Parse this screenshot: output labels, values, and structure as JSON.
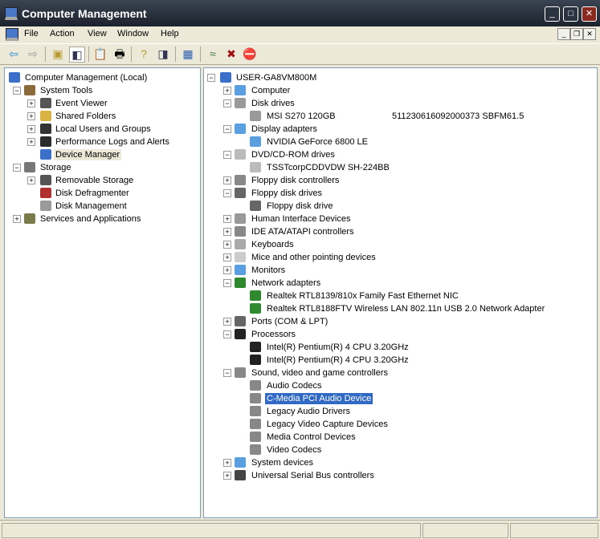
{
  "window": {
    "title": "Computer Management",
    "minimize": "_",
    "maximize": "□",
    "close": "✕"
  },
  "menu": [
    "File",
    "Action",
    "View",
    "Window",
    "Help"
  ],
  "toolbar": [
    "back-icon",
    "forward-icon",
    "up-folder-icon",
    "show-hide-tree-icon",
    "properties-icon",
    "print-icon",
    "help-icon",
    "console-icon",
    "scan-hardware-icon",
    "update-driver-icon",
    "uninstall-icon",
    "disable-icon"
  ],
  "left_tree": [
    {
      "label": "Computer Management (Local)",
      "level": 0,
      "exp": "",
      "icon": "computer"
    },
    {
      "label": "System Tools",
      "level": 1,
      "exp": "−",
      "icon": "tools"
    },
    {
      "label": "Event Viewer",
      "level": 2,
      "exp": "+",
      "icon": "event"
    },
    {
      "label": "Shared Folders",
      "level": 2,
      "exp": "+",
      "icon": "folder"
    },
    {
      "label": "Local Users and Groups",
      "level": 2,
      "exp": "+",
      "icon": "users"
    },
    {
      "label": "Performance Logs and Alerts",
      "level": 2,
      "exp": "+",
      "icon": "perf"
    },
    {
      "label": "Device Manager",
      "level": 2,
      "exp": "",
      "icon": "device",
      "state": "gsel"
    },
    {
      "label": "Storage",
      "level": 1,
      "exp": "−",
      "icon": "storage"
    },
    {
      "label": "Removable Storage",
      "level": 2,
      "exp": "+",
      "icon": "removable"
    },
    {
      "label": "Disk Defragmenter",
      "level": 2,
      "exp": "",
      "icon": "defrag"
    },
    {
      "label": "Disk Management",
      "level": 2,
      "exp": "",
      "icon": "disk"
    },
    {
      "label": "Services and Applications",
      "level": 1,
      "exp": "+",
      "icon": "services"
    }
  ],
  "right_tree": [
    {
      "label": "USER-GA8VM800M",
      "level": 0,
      "exp": "−",
      "icon": "computer"
    },
    {
      "label": "Computer",
      "level": 1,
      "exp": "+",
      "icon": "monitor"
    },
    {
      "label": "Disk drives",
      "level": 1,
      "exp": "−",
      "icon": "disk"
    },
    {
      "label": "MSI S270 120GB",
      "level": 2,
      "icon": "disk",
      "extra": "511230616092000373  SBFM61.5"
    },
    {
      "label": "Display adapters",
      "level": 1,
      "exp": "−",
      "icon": "monitor"
    },
    {
      "label": "NVIDIA GeForce 6800 LE",
      "level": 2,
      "icon": "monitor"
    },
    {
      "label": "DVD/CD-ROM drives",
      "level": 1,
      "exp": "−",
      "icon": "cd"
    },
    {
      "label": "TSSTcorpCDDVDW SH-224BB",
      "level": 2,
      "icon": "cd"
    },
    {
      "label": "Floppy disk controllers",
      "level": 1,
      "exp": "+",
      "icon": "controller"
    },
    {
      "label": "Floppy disk drives",
      "level": 1,
      "exp": "−",
      "icon": "floppy"
    },
    {
      "label": "Floppy disk drive",
      "level": 2,
      "icon": "floppy"
    },
    {
      "label": "Human Interface Devices",
      "level": 1,
      "exp": "+",
      "icon": "hid"
    },
    {
      "label": "IDE ATA/ATAPI controllers",
      "level": 1,
      "exp": "+",
      "icon": "controller"
    },
    {
      "label": "Keyboards",
      "level": 1,
      "exp": "+",
      "icon": "keyboard"
    },
    {
      "label": "Mice and other pointing devices",
      "level": 1,
      "exp": "+",
      "icon": "mouse"
    },
    {
      "label": "Monitors",
      "level": 1,
      "exp": "+",
      "icon": "monitor"
    },
    {
      "label": "Network adapters",
      "level": 1,
      "exp": "−",
      "icon": "network"
    },
    {
      "label": "Realtek RTL8139/810x Family Fast Ethernet NIC",
      "level": 2,
      "icon": "network"
    },
    {
      "label": "Realtek RTL8188FTV Wireless LAN 802.11n USB 2.0 Network Adapter",
      "level": 2,
      "icon": "network"
    },
    {
      "label": "Ports (COM & LPT)",
      "level": 1,
      "exp": "+",
      "icon": "port"
    },
    {
      "label": "Processors",
      "level": 1,
      "exp": "−",
      "icon": "cpu"
    },
    {
      "label": "Intel(R) Pentium(R) 4 CPU 3.20GHz",
      "level": 2,
      "icon": "cpu"
    },
    {
      "label": "Intel(R) Pentium(R) 4 CPU 3.20GHz",
      "level": 2,
      "icon": "cpu"
    },
    {
      "label": "Sound, video and game controllers",
      "level": 1,
      "exp": "−",
      "icon": "sound"
    },
    {
      "label": "Audio Codecs",
      "level": 2,
      "icon": "sound"
    },
    {
      "label": "C-Media PCI Audio Device",
      "level": 2,
      "icon": "sound",
      "state": "sel"
    },
    {
      "label": "Legacy Audio Drivers",
      "level": 2,
      "icon": "sound"
    },
    {
      "label": "Legacy Video Capture Devices",
      "level": 2,
      "icon": "sound"
    },
    {
      "label": "Media Control Devices",
      "level": 2,
      "icon": "sound"
    },
    {
      "label": "Video Codecs",
      "level": 2,
      "icon": "sound"
    },
    {
      "label": "System devices",
      "level": 1,
      "exp": "+",
      "icon": "monitor"
    },
    {
      "label": "Universal Serial Bus controllers",
      "level": 1,
      "exp": "+",
      "icon": "usb"
    }
  ],
  "colors": {
    "selection": "#316ac5",
    "titlebar": "#1c232d"
  }
}
